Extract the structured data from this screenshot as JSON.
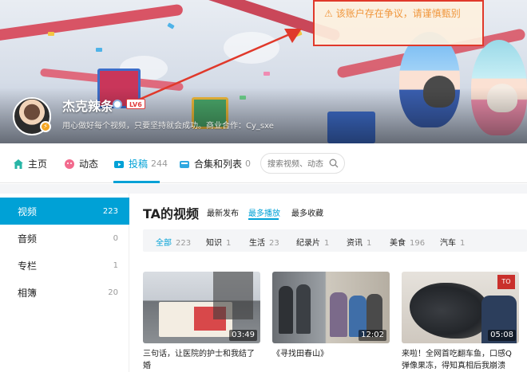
{
  "warning": {
    "text": "该账户存在争议，请谨慎甄别"
  },
  "profile": {
    "username": "杰克辣条",
    "level": "LV6",
    "signature": "用心做好每个视频，只要坚持就会成功。商业合作：Cy_sxe"
  },
  "nav": {
    "items": [
      {
        "label": "主页",
        "count": ""
      },
      {
        "label": "动态",
        "count": ""
      },
      {
        "label": "投稿",
        "count": "244"
      },
      {
        "label": "合集和列表",
        "count": "0"
      }
    ],
    "active_index": 2,
    "search_placeholder": "搜索视频、动态"
  },
  "sidebar": {
    "items": [
      {
        "label": "视频",
        "count": "223"
      },
      {
        "label": "音频",
        "count": "0"
      },
      {
        "label": "专栏",
        "count": "1"
      },
      {
        "label": "相簿",
        "count": "20"
      }
    ],
    "active_index": 0
  },
  "main": {
    "title": "TA的视频",
    "sort_tabs": [
      "最新发布",
      "最多播放",
      "最多收藏"
    ],
    "active_sort": 1,
    "filters": [
      {
        "label": "全部",
        "count": "223"
      },
      {
        "label": "知识",
        "count": "1"
      },
      {
        "label": "生活",
        "count": "23"
      },
      {
        "label": "纪录片",
        "count": "1"
      },
      {
        "label": "资讯",
        "count": "1"
      },
      {
        "label": "美食",
        "count": "196"
      },
      {
        "label": "汽车",
        "count": "1"
      }
    ],
    "videos": [
      {
        "duration": "03:49",
        "title": "三句话，让医院的护士和我结了婚"
      },
      {
        "duration": "12:02",
        "title": "《寻找田春山》"
      },
      {
        "duration": "05:08",
        "title": "来啦！全网首吃翻车鱼，口感Q弹像果冻，得知真相后我崩溃了！"
      }
    ]
  },
  "colors": {
    "accent": "#00a1d6",
    "warning_border": "#e0392b",
    "warning_text": "#f0963c"
  }
}
